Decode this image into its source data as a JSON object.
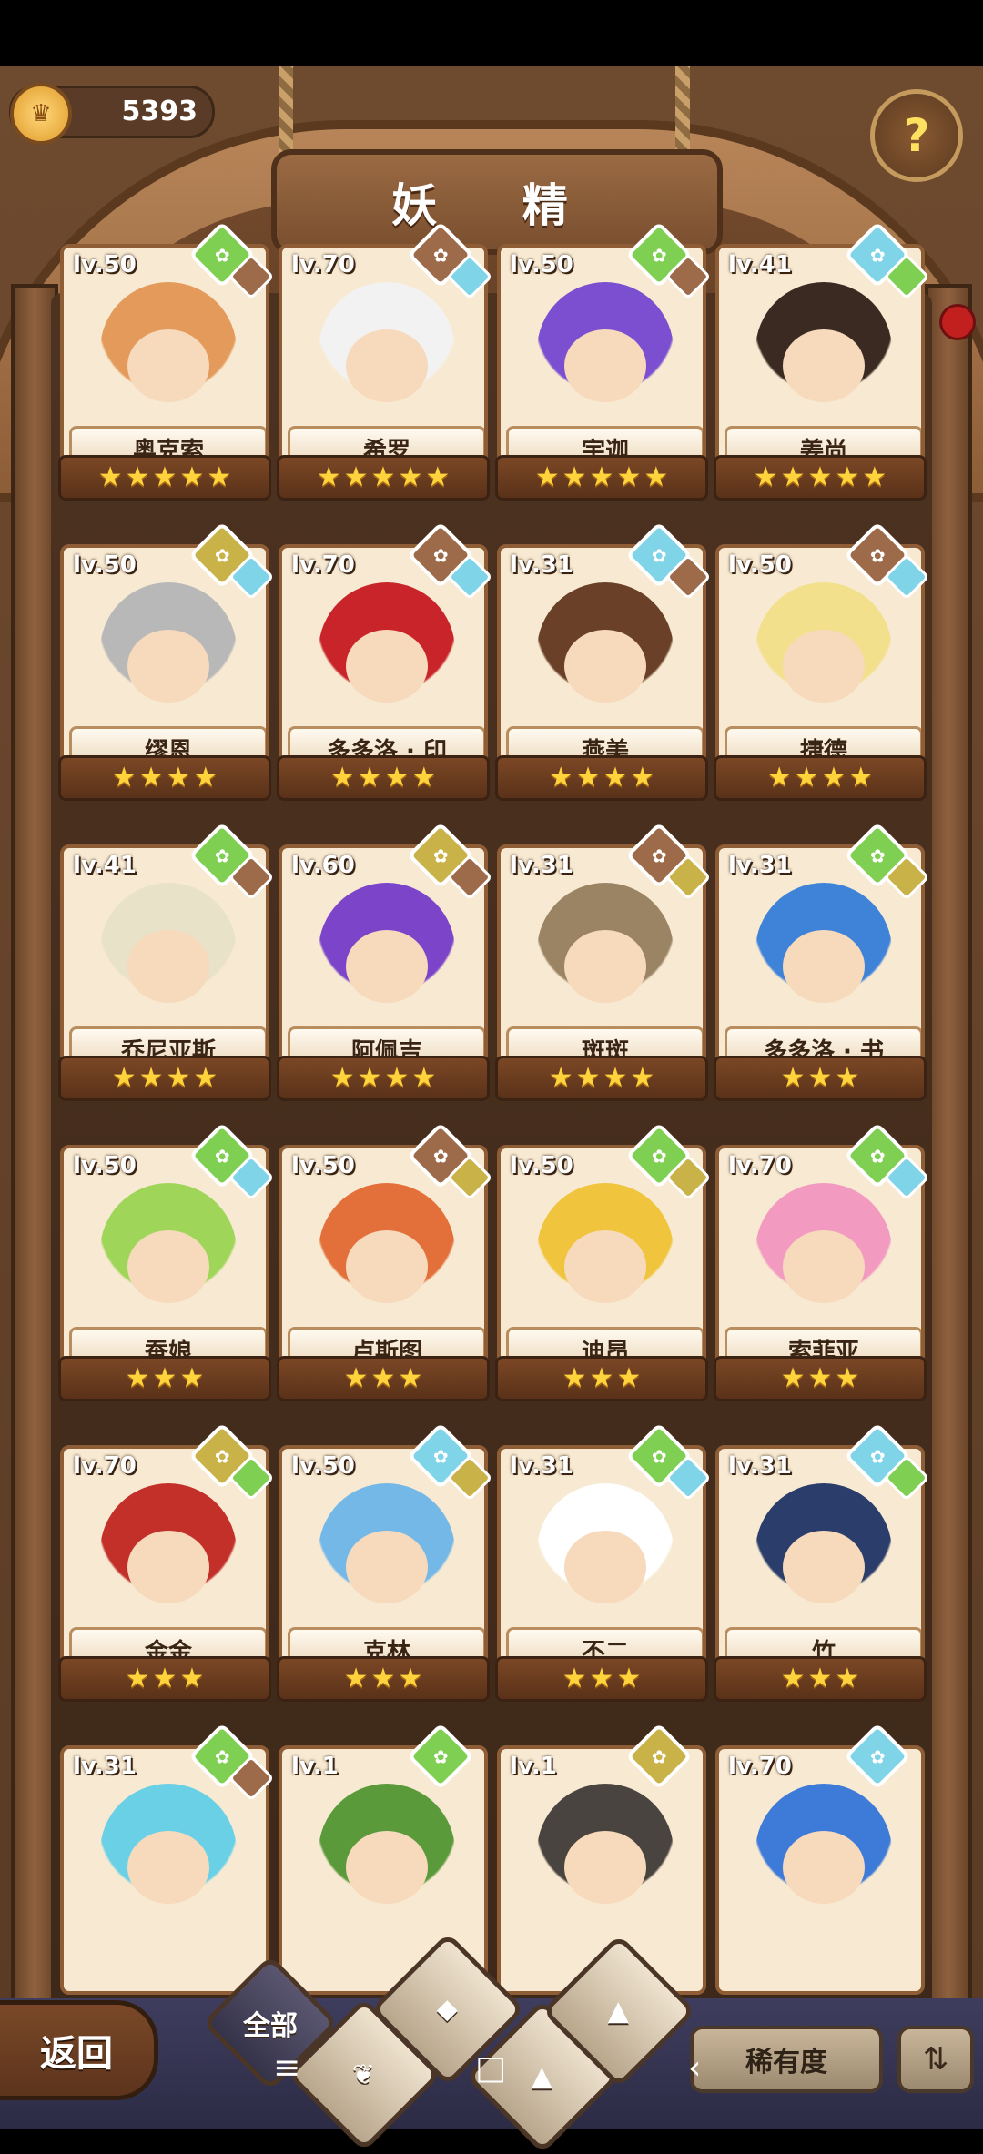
{
  "header": {
    "coins": "5393",
    "title": "妖 精",
    "help_icon": "question-sprout-icon"
  },
  "grid": [
    {
      "level": "lv.50",
      "name": "奥克索",
      "stars": 5,
      "gem": "green",
      "gem2": "brown",
      "hair": "#e39a5a"
    },
    {
      "level": "lv.70",
      "name": "希罗",
      "stars": 5,
      "gem": "brown",
      "gem2": "blue",
      "hair": "#f2f2f2"
    },
    {
      "level": "lv.50",
      "name": "宇迦",
      "stars": 5,
      "gem": "green",
      "gem2": "brown",
      "hair": "#7b4fd0"
    },
    {
      "level": "lv.41",
      "name": "姜尚",
      "stars": 5,
      "gem": "blue",
      "gem2": "green",
      "hair": "#3a2a22"
    },
    {
      "level": "lv.50",
      "name": "缪恩",
      "stars": 4,
      "gem": "olive",
      "gem2": "blue",
      "hair": "#b8b8b8"
    },
    {
      "level": "lv.70",
      "name": "多多洛 · 印",
      "stars": 4,
      "gem": "brown",
      "gem2": "blue",
      "hair": "#c9242a"
    },
    {
      "level": "lv.31",
      "name": "燕美",
      "stars": 4,
      "gem": "blue",
      "gem2": "brown",
      "hair": "#6a4128"
    },
    {
      "level": "lv.50",
      "name": "捷德",
      "stars": 4,
      "gem": "brown",
      "gem2": "blue",
      "hair": "#f2e08c"
    },
    {
      "level": "lv.41",
      "name": "乔尼亚斯",
      "stars": 4,
      "gem": "green",
      "gem2": "brown",
      "hair": "#e8e2c8"
    },
    {
      "level": "lv.60",
      "name": "阿佩吉",
      "stars": 4,
      "gem": "olive",
      "gem2": "brown",
      "hair": "#7c45c9"
    },
    {
      "level": "lv.31",
      "name": "斑斑",
      "stars": 4,
      "gem": "brown",
      "gem2": "olive",
      "hair": "#9b8464"
    },
    {
      "level": "lv.31",
      "name": "多多洛 · 书",
      "stars": 3,
      "gem": "green",
      "gem2": "olive",
      "hair": "#3f83d8"
    },
    {
      "level": "lv.50",
      "name": "蚕娘",
      "stars": 3,
      "gem": "green",
      "gem2": "blue",
      "hair": "#9fd65a"
    },
    {
      "level": "lv.50",
      "name": "卢斯图",
      "stars": 3,
      "gem": "brown",
      "gem2": "olive",
      "hair": "#e3703a"
    },
    {
      "level": "lv.50",
      "name": "迪昂",
      "stars": 3,
      "gem": "green",
      "gem2": "olive",
      "hair": "#f0c43c"
    },
    {
      "level": "lv.70",
      "name": "索菲亚",
      "stars": 3,
      "gem": "green",
      "gem2": "blue",
      "hair": "#f39ac0"
    },
    {
      "level": "lv.70",
      "name": "金金",
      "stars": 3,
      "gem": "olive",
      "gem2": "green",
      "hair": "#c3302a"
    },
    {
      "level": "lv.50",
      "name": "克林",
      "stars": 3,
      "gem": "blue",
      "gem2": "olive",
      "hair": "#74b8e8"
    },
    {
      "level": "lv.31",
      "name": "不二",
      "stars": 3,
      "gem": "green",
      "gem2": "blue",
      "hair": "#ffffff"
    },
    {
      "level": "lv.31",
      "name": "竹",
      "stars": 3,
      "gem": "blue",
      "gem2": "green",
      "hair": "#2b3d6a"
    },
    {
      "level": "lv.31",
      "name": "",
      "stars": 0,
      "gem": "green",
      "gem2": "brown",
      "hair": "#6ad0e6"
    },
    {
      "level": "lv.1",
      "name": "",
      "stars": 0,
      "gem": "green",
      "gem2": "",
      "hair": "#5a9a3a"
    },
    {
      "level": "lv.1",
      "name": "",
      "stars": 0,
      "gem": "olive",
      "gem2": "",
      "hair": "#4a4440"
    },
    {
      "level": "lv.70",
      "name": "",
      "stars": 0,
      "gem": "blue",
      "gem2": "",
      "hair": "#3e7bd8"
    }
  ],
  "footer": {
    "back_label": "返回",
    "filter_all_label": "全部",
    "filter_icons": [
      "sprout-icon",
      "water-drop-icon",
      "earth-icon",
      "mountain-icon"
    ],
    "rarity_label": "稀有度",
    "sort_icon": "sort-icon",
    "nav": [
      "≡",
      "□",
      "‹"
    ]
  },
  "colors": {
    "green": "#7fcf52",
    "blue": "#7fd4e8",
    "brown": "#9d6b4a",
    "olive": "#c9b247"
  }
}
